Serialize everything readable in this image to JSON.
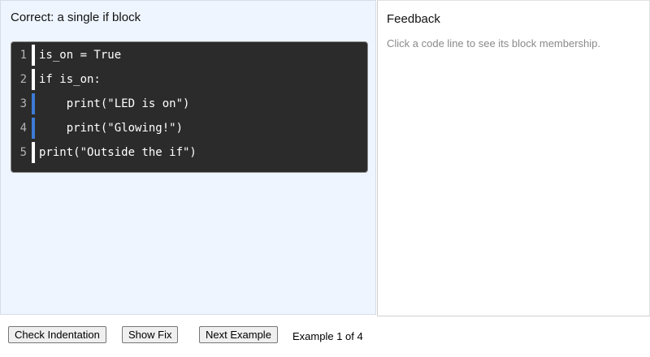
{
  "left_panel": {
    "title": "Correct: a single if block"
  },
  "code": {
    "lines": [
      {
        "number": "1",
        "text": "is_on = True",
        "indented": false
      },
      {
        "number": "2",
        "text": "if is_on:",
        "indented": false
      },
      {
        "number": "3",
        "text": "    print(\"LED is on\")",
        "indented": true
      },
      {
        "number": "4",
        "text": "    print(\"Glowing!\")",
        "indented": true
      },
      {
        "number": "5",
        "text": "print(\"Outside the if\")",
        "indented": false
      }
    ],
    "colors": {
      "background": "#2b2b2b",
      "marker_default": "#ffffff",
      "marker_block": "#3d7bd6"
    }
  },
  "feedback": {
    "title": "Feedback",
    "hint": "Click a code line to see its block membership."
  },
  "controls": {
    "check_label": "Check Indentation",
    "fix_label": "Show Fix",
    "next_label": "Next Example",
    "counter": "Example 1 of 4"
  }
}
